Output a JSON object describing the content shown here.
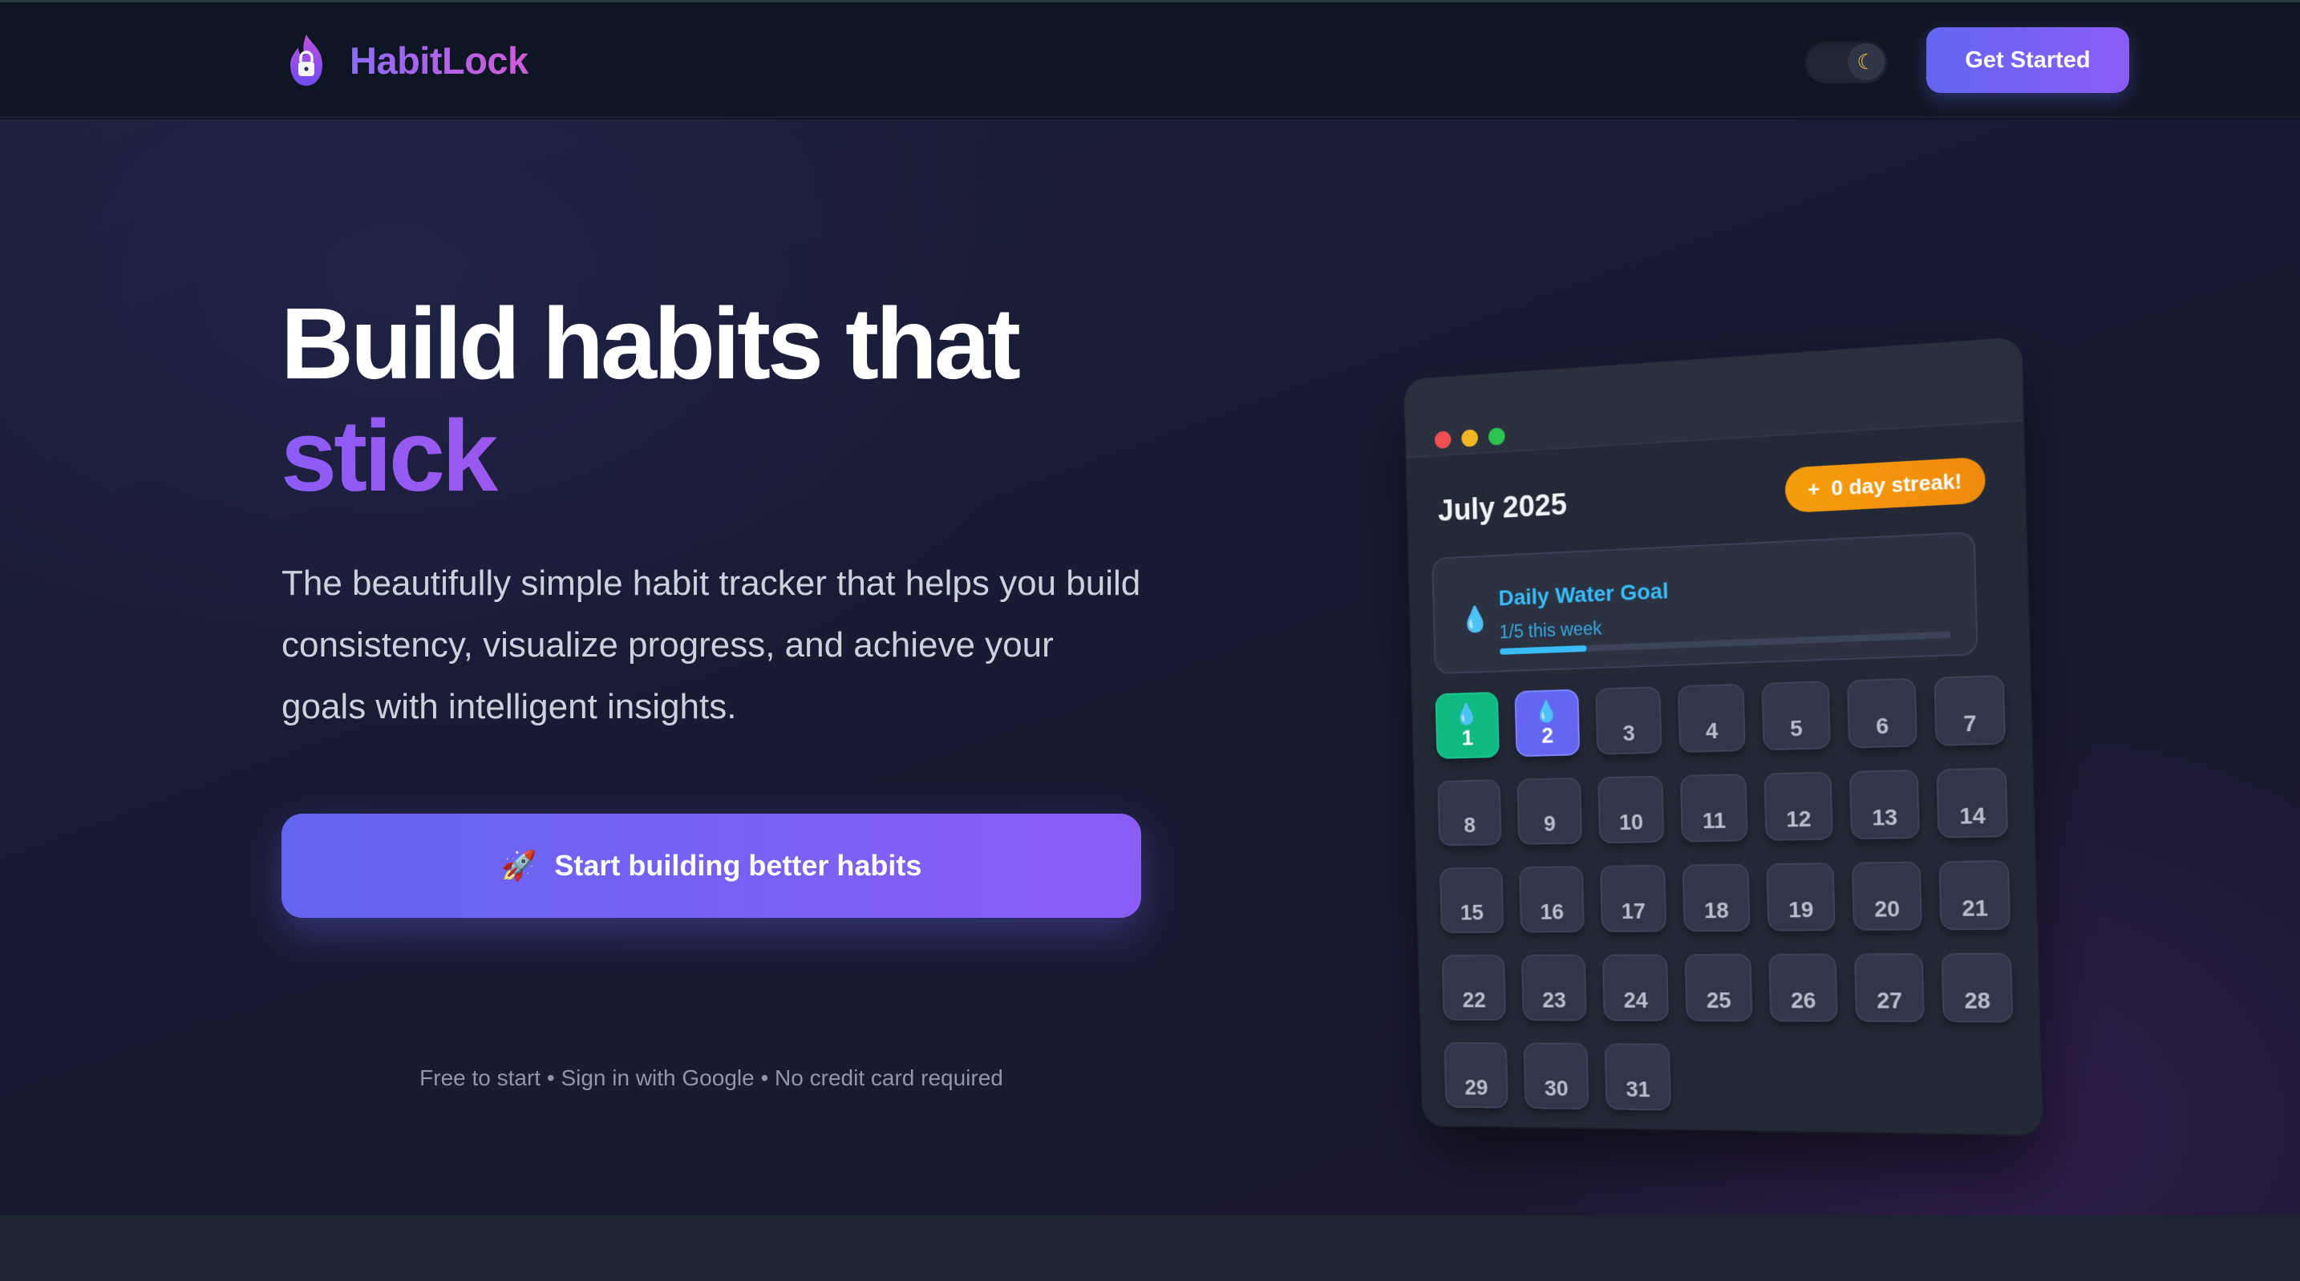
{
  "nav": {
    "brand_name": "HabitLock",
    "theme_icon": "moon-icon",
    "cta_label": "Get Started"
  },
  "hero": {
    "headline_line1": "Build habits that",
    "headline_line2": "stick",
    "subtitle": "The beautifully simple habit tracker that helps you build consistency, visualize progress, and achieve your goals with intelligent insights.",
    "cta_icon": "🚀",
    "cta_label": "Start building better habits",
    "fine_print": "Free to start • Sign in with Google • No credit card required"
  },
  "mockup": {
    "month": "July 2025",
    "streak_icon": "+",
    "streak_label": "0 day streak!",
    "goal": {
      "icon": "💧",
      "title": "Daily Water Goal",
      "progress_text": "1/5 this week",
      "progress": 0.2
    },
    "days": [
      {
        "n": "1",
        "state": "green"
      },
      {
        "n": "2",
        "state": "purple"
      },
      {
        "n": "3"
      },
      {
        "n": "4"
      },
      {
        "n": "5"
      },
      {
        "n": "6"
      },
      {
        "n": "7"
      },
      {
        "n": "8"
      },
      {
        "n": "9"
      },
      {
        "n": "10"
      },
      {
        "n": "11"
      },
      {
        "n": "12"
      },
      {
        "n": "13"
      },
      {
        "n": "14"
      },
      {
        "n": "15"
      },
      {
        "n": "16"
      },
      {
        "n": "17"
      },
      {
        "n": "18"
      },
      {
        "n": "19"
      },
      {
        "n": "20"
      },
      {
        "n": "21"
      },
      {
        "n": "22"
      },
      {
        "n": "23"
      },
      {
        "n": "24"
      },
      {
        "n": "25"
      },
      {
        "n": "26"
      },
      {
        "n": "27"
      },
      {
        "n": "28"
      },
      {
        "n": "29"
      },
      {
        "n": "30"
      },
      {
        "n": "31"
      }
    ]
  },
  "colors": {
    "accent_start": "#6366f1",
    "accent_end": "#8b5cf6",
    "streak": "#f59e0b",
    "water": "#38bdf8",
    "done_green": "#10b981"
  }
}
